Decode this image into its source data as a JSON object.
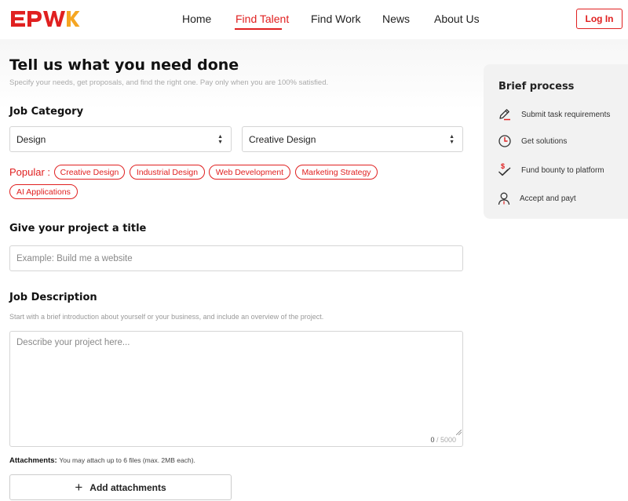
{
  "header": {
    "logo": "EPWK",
    "nav": [
      {
        "label": "Home"
      },
      {
        "label": "Find Talent"
      },
      {
        "label": "Find Work"
      },
      {
        "label": "News"
      },
      {
        "label": "About Us"
      }
    ],
    "active_nav": "Find Talent",
    "login_label": "Log In"
  },
  "main": {
    "title": "Tell us what you need done",
    "subtitle": "Specify your needs, get proposals, and find the right one. Pay only when you are 100% satisfied.",
    "job_category": {
      "label": "Job Category",
      "category_value": "Design",
      "subcategory_value": "Creative Design"
    },
    "popular": {
      "label": "Popular :",
      "tags": [
        "Creative Design",
        "Industrial Design",
        "Web Development",
        "Marketing Strategy",
        "AI Applications"
      ]
    },
    "project_title": {
      "label": "Give your project a title",
      "placeholder": "Example: Build me a website"
    },
    "description": {
      "label": "Job Description",
      "hint": "Start with a brief introduction about yourself or your business, and include an overview of the project.",
      "placeholder": "Describe your project here...",
      "count": "0",
      "max": "/ 5000"
    },
    "attachments": {
      "label": "Attachments:",
      "note": "You may attach up to 6 files (max. 2MB each).",
      "button_label": "Add attachments"
    }
  },
  "side_panel": {
    "title": "Brief process",
    "steps": [
      {
        "label": "Submit task requirements",
        "icon": "pencil-icon"
      },
      {
        "label": "Get solutions",
        "icon": "clock-icon"
      },
      {
        "label": "Fund bounty to platform",
        "icon": "dollar-check-icon"
      },
      {
        "label": "Accept and payt",
        "icon": "person-icon"
      }
    ]
  },
  "colors": {
    "accent": "#e02020",
    "logo_orange": "#f5a623",
    "panel_bg": "#f2f2f2"
  }
}
